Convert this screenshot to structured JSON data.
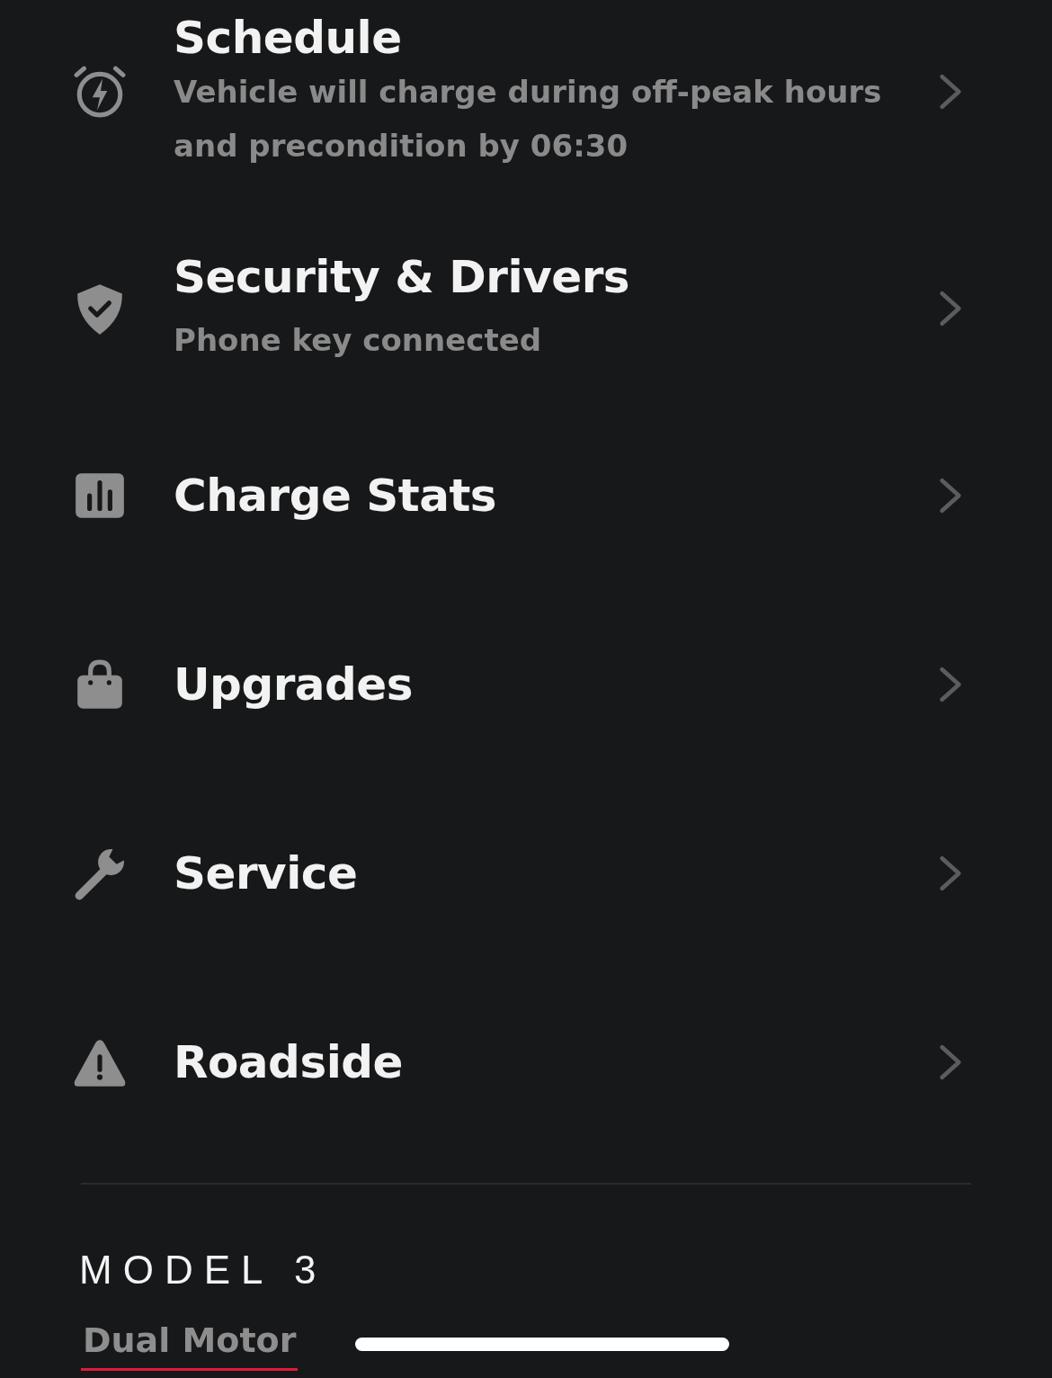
{
  "menu_items": [
    {
      "title": "Schedule",
      "subtitle": "Vehicle will charge during off-peak hours and precondition by 06:30"
    },
    {
      "title": "Security & Drivers",
      "subtitle": "Phone key connected"
    },
    {
      "title": "Charge Stats"
    },
    {
      "title": "Upgrades"
    },
    {
      "title": "Service"
    },
    {
      "title": "Roadside"
    }
  ],
  "vehicle": {
    "model": "MODEL 3",
    "tabs": [
      {
        "label": "Dual Motor",
        "selected": true
      }
    ]
  }
}
